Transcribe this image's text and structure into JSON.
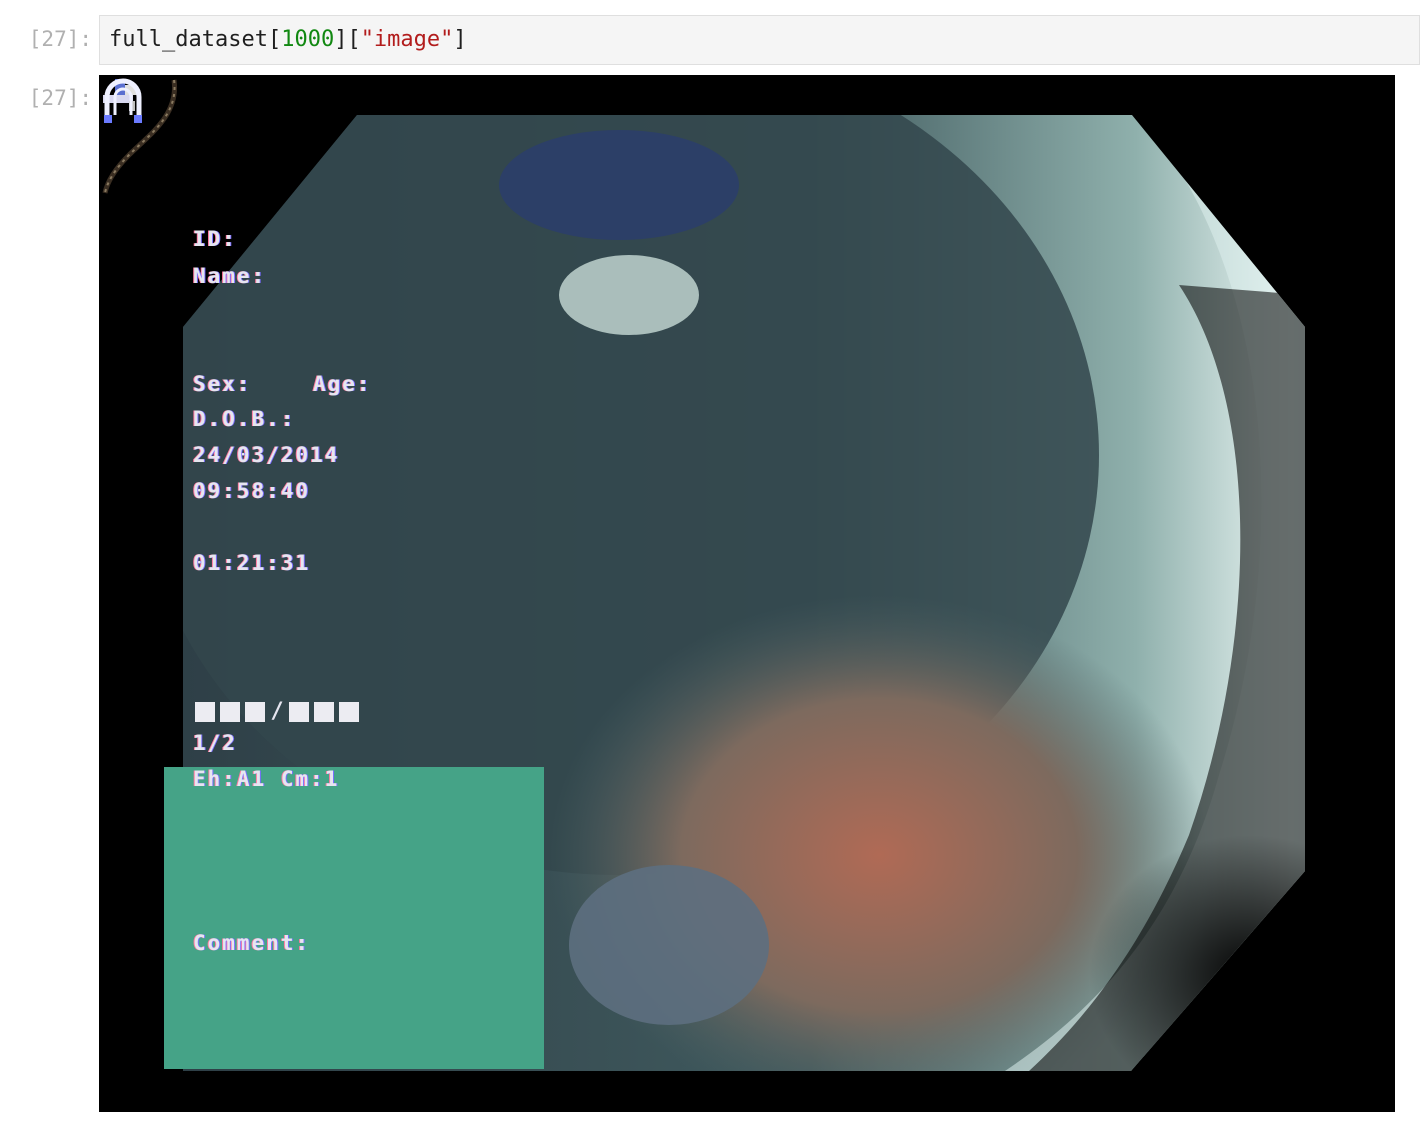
{
  "input_cell": {
    "prompt": "[27]:",
    "code_var": "full_dataset",
    "code_open1": "[",
    "code_index": "1000",
    "code_close1": "][",
    "code_key": "\"image\"",
    "code_close2": "]"
  },
  "output_cell": {
    "prompt": "[27]:"
  },
  "overlay": {
    "id_label": "ID:",
    "name_label": "Name:",
    "sex_label": "Sex:",
    "age_label": "Age:",
    "dob_label": "D.O.B.:",
    "date": "24/03/2014",
    "time": "09:58:40",
    "elapsed": "01:21:31",
    "page": "1/2",
    "settings": "Eh:A1 Cm:1",
    "comment_label": "Comment:"
  },
  "icons": {
    "scope": "magnet-scope-icon",
    "tool": "tool-icon"
  },
  "colors": {
    "comment_box": "#45a387",
    "prompt": "#b0b0b0",
    "number": "#118811",
    "string": "#b21c1c"
  }
}
